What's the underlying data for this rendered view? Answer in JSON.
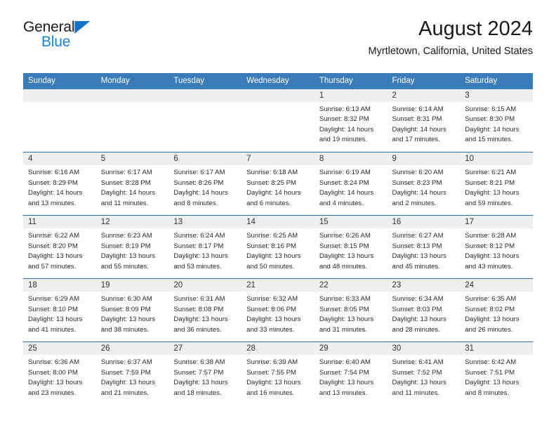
{
  "brand": {
    "name_top": "General",
    "name_bottom": "Blue",
    "triangle_color": "#1473c6",
    "blue_color": "#1b81d6"
  },
  "header": {
    "title": "August 2024",
    "subtitle": "Myrtletown, California, United States"
  },
  "theme": {
    "header_bg": "#3a7cba",
    "row_divider": "#2e6da4",
    "daynum_bg": "#efefef"
  },
  "weekday_headers": [
    "Sunday",
    "Monday",
    "Tuesday",
    "Wednesday",
    "Thursday",
    "Friday",
    "Saturday"
  ],
  "weeks": [
    [
      {
        "day": "",
        "sunrise": "",
        "sunset": "",
        "daylight1": "",
        "daylight2": ""
      },
      {
        "day": "",
        "sunrise": "",
        "sunset": "",
        "daylight1": "",
        "daylight2": ""
      },
      {
        "day": "",
        "sunrise": "",
        "sunset": "",
        "daylight1": "",
        "daylight2": ""
      },
      {
        "day": "",
        "sunrise": "",
        "sunset": "",
        "daylight1": "",
        "daylight2": ""
      },
      {
        "day": "1",
        "sunrise": "Sunrise: 6:13 AM",
        "sunset": "Sunset: 8:32 PM",
        "daylight1": "Daylight: 14 hours",
        "daylight2": "and 19 minutes."
      },
      {
        "day": "2",
        "sunrise": "Sunrise: 6:14 AM",
        "sunset": "Sunset: 8:31 PM",
        "daylight1": "Daylight: 14 hours",
        "daylight2": "and 17 minutes."
      },
      {
        "day": "3",
        "sunrise": "Sunrise: 6:15 AM",
        "sunset": "Sunset: 8:30 PM",
        "daylight1": "Daylight: 14 hours",
        "daylight2": "and 15 minutes."
      }
    ],
    [
      {
        "day": "4",
        "sunrise": "Sunrise: 6:16 AM",
        "sunset": "Sunset: 8:29 PM",
        "daylight1": "Daylight: 14 hours",
        "daylight2": "and 13 minutes."
      },
      {
        "day": "5",
        "sunrise": "Sunrise: 6:17 AM",
        "sunset": "Sunset: 8:28 PM",
        "daylight1": "Daylight: 14 hours",
        "daylight2": "and 11 minutes."
      },
      {
        "day": "6",
        "sunrise": "Sunrise: 6:17 AM",
        "sunset": "Sunset: 8:26 PM",
        "daylight1": "Daylight: 14 hours",
        "daylight2": "and 8 minutes."
      },
      {
        "day": "7",
        "sunrise": "Sunrise: 6:18 AM",
        "sunset": "Sunset: 8:25 PM",
        "daylight1": "Daylight: 14 hours",
        "daylight2": "and 6 minutes."
      },
      {
        "day": "8",
        "sunrise": "Sunrise: 6:19 AM",
        "sunset": "Sunset: 8:24 PM",
        "daylight1": "Daylight: 14 hours",
        "daylight2": "and 4 minutes."
      },
      {
        "day": "9",
        "sunrise": "Sunrise: 6:20 AM",
        "sunset": "Sunset: 8:23 PM",
        "daylight1": "Daylight: 14 hours",
        "daylight2": "and 2 minutes."
      },
      {
        "day": "10",
        "sunrise": "Sunrise: 6:21 AM",
        "sunset": "Sunset: 8:21 PM",
        "daylight1": "Daylight: 13 hours",
        "daylight2": "and 59 minutes."
      }
    ],
    [
      {
        "day": "11",
        "sunrise": "Sunrise: 6:22 AM",
        "sunset": "Sunset: 8:20 PM",
        "daylight1": "Daylight: 13 hours",
        "daylight2": "and 57 minutes."
      },
      {
        "day": "12",
        "sunrise": "Sunrise: 6:23 AM",
        "sunset": "Sunset: 8:19 PM",
        "daylight1": "Daylight: 13 hours",
        "daylight2": "and 55 minutes."
      },
      {
        "day": "13",
        "sunrise": "Sunrise: 6:24 AM",
        "sunset": "Sunset: 8:17 PM",
        "daylight1": "Daylight: 13 hours",
        "daylight2": "and 53 minutes."
      },
      {
        "day": "14",
        "sunrise": "Sunrise: 6:25 AM",
        "sunset": "Sunset: 8:16 PM",
        "daylight1": "Daylight: 13 hours",
        "daylight2": "and 50 minutes."
      },
      {
        "day": "15",
        "sunrise": "Sunrise: 6:26 AM",
        "sunset": "Sunset: 8:15 PM",
        "daylight1": "Daylight: 13 hours",
        "daylight2": "and 48 minutes."
      },
      {
        "day": "16",
        "sunrise": "Sunrise: 6:27 AM",
        "sunset": "Sunset: 8:13 PM",
        "daylight1": "Daylight: 13 hours",
        "daylight2": "and 45 minutes."
      },
      {
        "day": "17",
        "sunrise": "Sunrise: 6:28 AM",
        "sunset": "Sunset: 8:12 PM",
        "daylight1": "Daylight: 13 hours",
        "daylight2": "and 43 minutes."
      }
    ],
    [
      {
        "day": "18",
        "sunrise": "Sunrise: 6:29 AM",
        "sunset": "Sunset: 8:10 PM",
        "daylight1": "Daylight: 13 hours",
        "daylight2": "and 41 minutes."
      },
      {
        "day": "19",
        "sunrise": "Sunrise: 6:30 AM",
        "sunset": "Sunset: 8:09 PM",
        "daylight1": "Daylight: 13 hours",
        "daylight2": "and 38 minutes."
      },
      {
        "day": "20",
        "sunrise": "Sunrise: 6:31 AM",
        "sunset": "Sunset: 8:08 PM",
        "daylight1": "Daylight: 13 hours",
        "daylight2": "and 36 minutes."
      },
      {
        "day": "21",
        "sunrise": "Sunrise: 6:32 AM",
        "sunset": "Sunset: 8:06 PM",
        "daylight1": "Daylight: 13 hours",
        "daylight2": "and 33 minutes."
      },
      {
        "day": "22",
        "sunrise": "Sunrise: 6:33 AM",
        "sunset": "Sunset: 8:05 PM",
        "daylight1": "Daylight: 13 hours",
        "daylight2": "and 31 minutes."
      },
      {
        "day": "23",
        "sunrise": "Sunrise: 6:34 AM",
        "sunset": "Sunset: 8:03 PM",
        "daylight1": "Daylight: 13 hours",
        "daylight2": "and 28 minutes."
      },
      {
        "day": "24",
        "sunrise": "Sunrise: 6:35 AM",
        "sunset": "Sunset: 8:02 PM",
        "daylight1": "Daylight: 13 hours",
        "daylight2": "and 26 minutes."
      }
    ],
    [
      {
        "day": "25",
        "sunrise": "Sunrise: 6:36 AM",
        "sunset": "Sunset: 8:00 PM",
        "daylight1": "Daylight: 13 hours",
        "daylight2": "and 23 minutes."
      },
      {
        "day": "26",
        "sunrise": "Sunrise: 6:37 AM",
        "sunset": "Sunset: 7:59 PM",
        "daylight1": "Daylight: 13 hours",
        "daylight2": "and 21 minutes."
      },
      {
        "day": "27",
        "sunrise": "Sunrise: 6:38 AM",
        "sunset": "Sunset: 7:57 PM",
        "daylight1": "Daylight: 13 hours",
        "daylight2": "and 18 minutes."
      },
      {
        "day": "28",
        "sunrise": "Sunrise: 6:39 AM",
        "sunset": "Sunset: 7:55 PM",
        "daylight1": "Daylight: 13 hours",
        "daylight2": "and 16 minutes."
      },
      {
        "day": "29",
        "sunrise": "Sunrise: 6:40 AM",
        "sunset": "Sunset: 7:54 PM",
        "daylight1": "Daylight: 13 hours",
        "daylight2": "and 13 minutes."
      },
      {
        "day": "30",
        "sunrise": "Sunrise: 6:41 AM",
        "sunset": "Sunset: 7:52 PM",
        "daylight1": "Daylight: 13 hours",
        "daylight2": "and 11 minutes."
      },
      {
        "day": "31",
        "sunrise": "Sunrise: 6:42 AM",
        "sunset": "Sunset: 7:51 PM",
        "daylight1": "Daylight: 13 hours",
        "daylight2": "and 8 minutes."
      }
    ]
  ]
}
